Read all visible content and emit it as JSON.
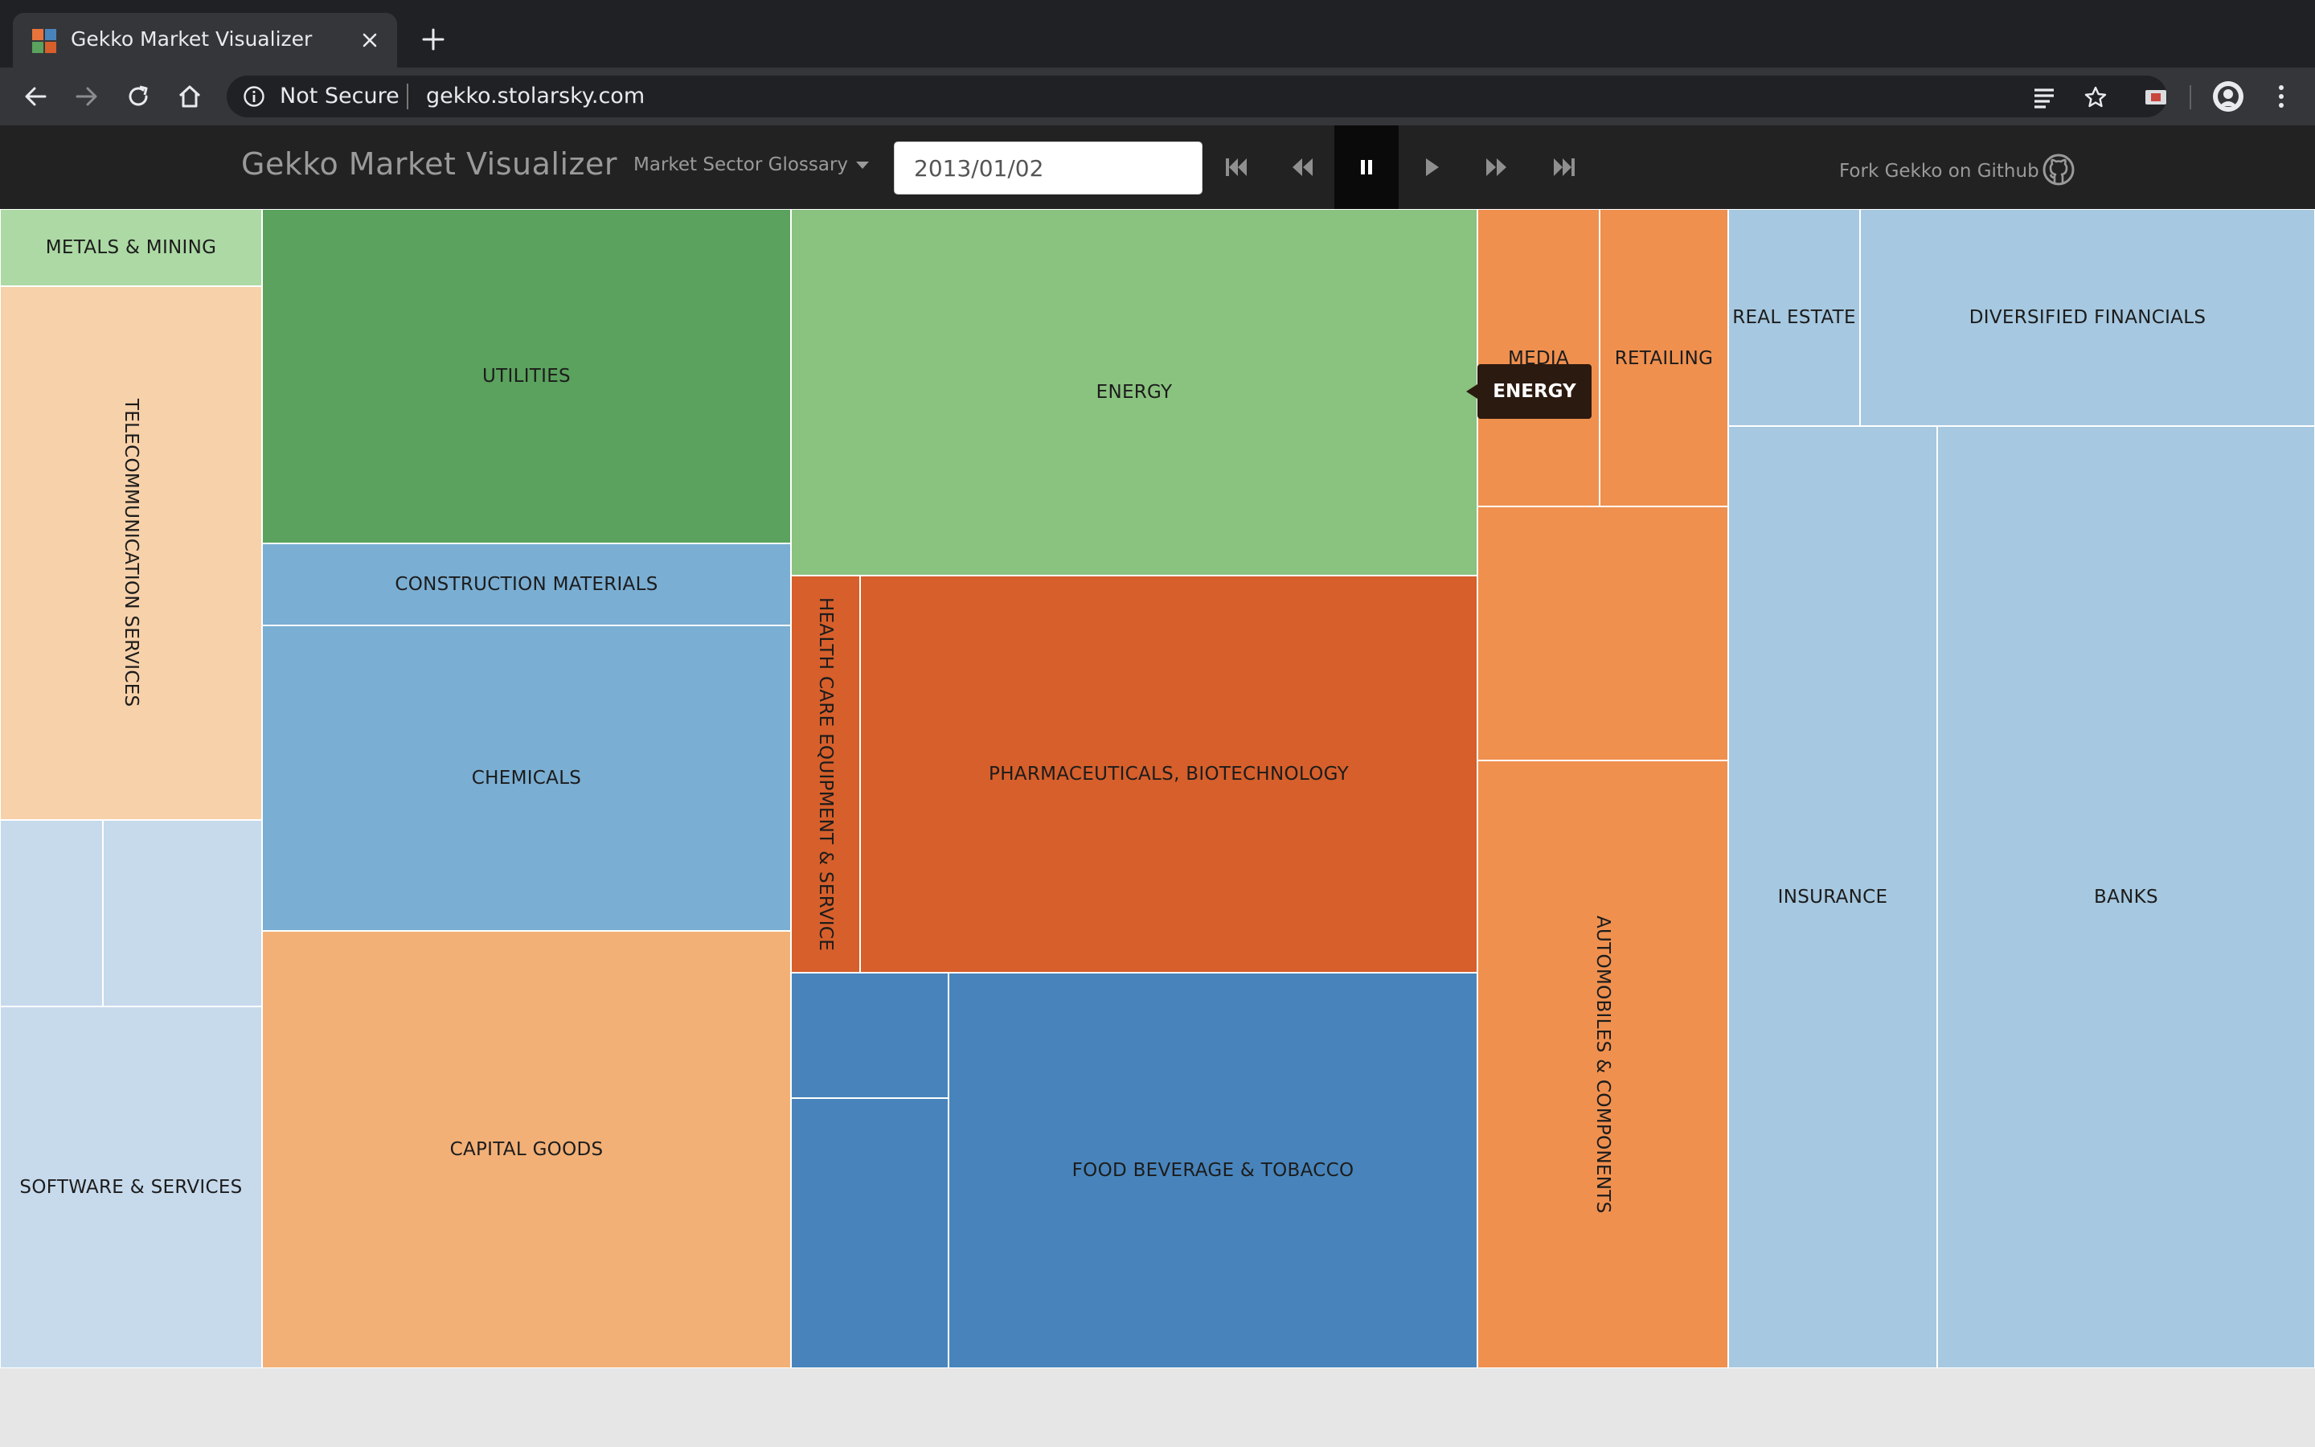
{
  "browser": {
    "tab_title": "Gekko Market Visualizer",
    "security_label": "Not Secure",
    "url": "gekko.stolarsky.com"
  },
  "app": {
    "title": "Gekko Market Visualizer",
    "glossary_label": "Market Sector Glossary",
    "date_value": "2013/01/02",
    "fork_label": "Fork Gekko on Github"
  },
  "tooltip": {
    "text": "ENERGY"
  },
  "treemap": {
    "sectors": [
      {
        "label": "Metals & Mining",
        "color": "#acd9a4"
      },
      {
        "label": "Telecommunication Services",
        "color": "#f7d1a9"
      },
      {
        "label": "",
        "color": "#c7daec"
      },
      {
        "label": "",
        "color": "#c7daec"
      },
      {
        "label": "Software & Services",
        "color": "#c7daec"
      },
      {
        "label": "Utilities",
        "color": "#5aa25d"
      },
      {
        "label": "Construction Materials",
        "color": "#7aaed3"
      },
      {
        "label": "Chemicals",
        "color": "#7aaed3"
      },
      {
        "label": "Capital Goods",
        "color": "#f2b077"
      },
      {
        "label": "Energy",
        "color": "#8ac27f"
      },
      {
        "label": "Health Care Equipment & Service",
        "color": "#d65f2b"
      },
      {
        "label": "Pharmaceuticals, Biotechnology",
        "color": "#d65f2b"
      },
      {
        "label": "",
        "color": "#4884bb"
      },
      {
        "label": "",
        "color": "#4884bb"
      },
      {
        "label": "Food Beverage & Tobacco",
        "color": "#4884bb"
      },
      {
        "label": "Media",
        "color": "#ef904f"
      },
      {
        "label": "Retailing",
        "color": "#ef904f"
      },
      {
        "label": "",
        "color": "#ef904f"
      },
      {
        "label": "Automobiles & Components",
        "color": "#ef904f"
      },
      {
        "label": "Real Estate",
        "color": "#a6c8e0"
      },
      {
        "label": "Diversified Financials",
        "color": "#a6c8e0"
      },
      {
        "label": "Insurance",
        "color": "#a6c8e0"
      },
      {
        "label": "Banks",
        "color": "#a6c8e0"
      }
    ]
  }
}
